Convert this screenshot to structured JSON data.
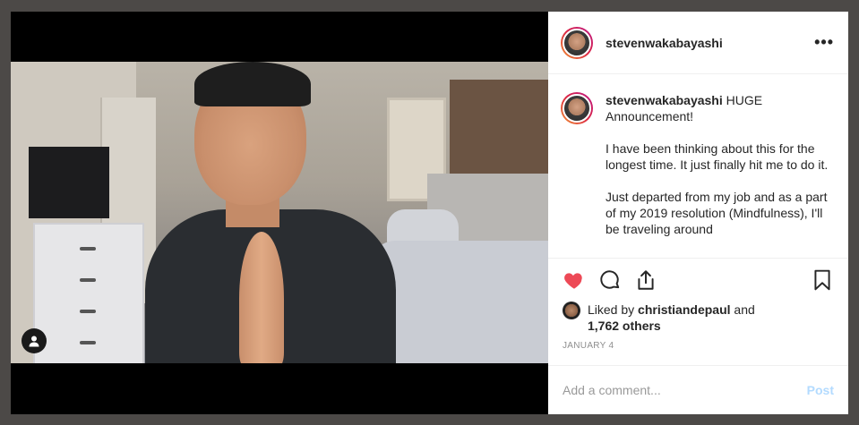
{
  "post": {
    "username": "stevenwakabayashi",
    "more_icon": "more-horizontal-icon",
    "caption_title": " HUGE Announcement!",
    "caption_p1": "I have been thinking about this for the longest time. It just finally hit me to do it.",
    "caption_p2": "Just departed from my job and as a part of my 2019 resolution (Mindfulness), I'll be traveling around"
  },
  "actions": {
    "like_icon": "heart-icon",
    "comment_icon": "comment-icon",
    "share_icon": "share-icon",
    "save_icon": "bookmark-icon",
    "like_color": "#ed4956"
  },
  "likes": {
    "prefix": "Liked by ",
    "user": "christiandepaul",
    "and": " and",
    "others": "1,762 others"
  },
  "date": "JANUARY 4",
  "comment": {
    "placeholder": "Add a comment...",
    "post_label": "Post"
  },
  "colors": {
    "story_ring": "#dc2743",
    "post_button_disabled": "#b3dbff"
  }
}
